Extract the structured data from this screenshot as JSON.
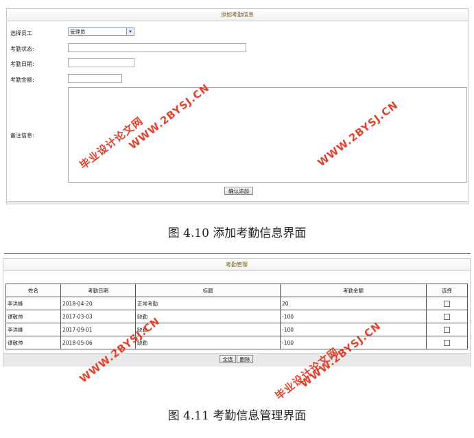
{
  "add_form": {
    "title": "添加考勤信息",
    "fields": {
      "employee_label": "选择员工",
      "employee_value": "管理员",
      "status_label": "考勤状态:",
      "status_value": "",
      "date_label": "考勤日期:",
      "date_value": "",
      "amount_label": "考勤金额:",
      "amount_value": "",
      "remark_label": "备注信息:",
      "remark_value": ""
    },
    "submit_label": "确认添加"
  },
  "caption1": "图 4.10  添加考勤信息界面",
  "manage": {
    "title": "考勤管理",
    "columns": [
      "姓名",
      "考勤日期",
      "标题",
      "考勤金额",
      "选择"
    ],
    "rows": [
      {
        "name": "李洪峰",
        "date": "2018-04-20",
        "title": "正常考勤",
        "amount": "20"
      },
      {
        "name": "谭敬帅",
        "date": "2017-03-03",
        "title": "缺勤",
        "amount": "-100"
      },
      {
        "name": "李洪峰",
        "date": "2017-09-01",
        "title": "缺勤",
        "amount": "-100"
      },
      {
        "name": "谭敬帅",
        "date": "2018-05-06",
        "title": "缺勤",
        "amount": "-100"
      }
    ],
    "select_all_label": "全选",
    "delete_label": "删除"
  },
  "caption2": "图 4.11  考勤信息管理界面",
  "watermark": {
    "site": "WWW.2BYSJ.CN",
    "name": "毕业设计论文网",
    "color": "#e0432f"
  }
}
